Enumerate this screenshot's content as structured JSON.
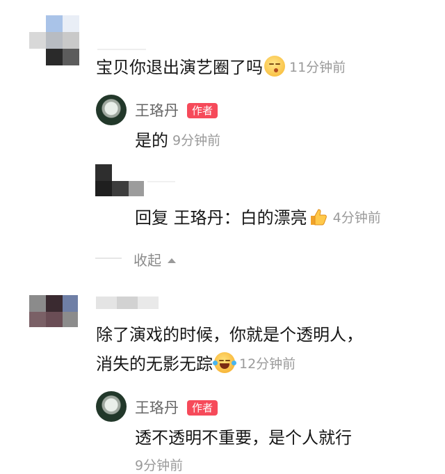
{
  "comments": [
    {
      "text": "宝贝你退出演艺圈了吗",
      "emoji": "kiss-face-emoji",
      "time": "11分钟前",
      "replies": [
        {
          "author": "王珞丹",
          "badge": "作者",
          "text": "是的",
          "time": "9分钟前"
        },
        {
          "author": "",
          "text": "回复 王珞丹：白的漂亮",
          "emoji": "thumbs-up-emoji",
          "time": "4分钟前"
        }
      ],
      "collapse_label": "收起",
      "collapse_icon": "triangle-up-icon"
    },
    {
      "text_line1": "除了演戏的时候，你就是个透明人，",
      "text_line2": "消失的无影无踪",
      "emoji": "laughing-tears-emoji",
      "time": "12分钟前",
      "replies": [
        {
          "author": "王珞丹",
          "badge": "作者",
          "text": "透不透明不重要，是个人就行",
          "time": "9分钟前"
        }
      ]
    }
  ],
  "colors": {
    "badge": "#f64a5a",
    "time": "#9a9a9a",
    "name": "#666666"
  }
}
